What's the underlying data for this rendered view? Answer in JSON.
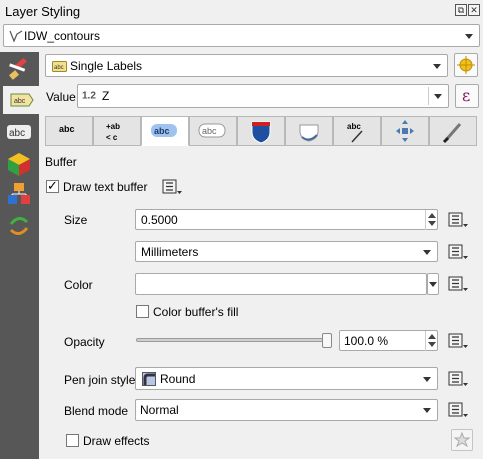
{
  "panel": {
    "title": "Layer Styling"
  },
  "layer_select": {
    "value": "IDW_contours"
  },
  "renderer": {
    "value": "Single Labels"
  },
  "value_row": {
    "label": "Value",
    "type_badge": "1.2",
    "value": "Z"
  },
  "tabs": [
    {
      "name": "text",
      "glyph": "abc"
    },
    {
      "name": "formatting",
      "glyph": "+ab c"
    },
    {
      "name": "buffer",
      "glyph": "abc",
      "active": true
    },
    {
      "name": "mask",
      "glyph": "abc"
    },
    {
      "name": "background",
      "glyph": ""
    },
    {
      "name": "shadow",
      "glyph": ""
    },
    {
      "name": "callouts",
      "glyph": "abc"
    },
    {
      "name": "placement",
      "glyph": ""
    },
    {
      "name": "rendering",
      "glyph": ""
    }
  ],
  "buffer": {
    "section_title": "Buffer",
    "draw_text_buffer_label": "Draw text buffer",
    "draw_text_buffer_checked": true,
    "size_label": "Size",
    "size_value": "0.5000",
    "units_value": "Millimeters",
    "color_label": "Color",
    "color_fill_label": "Color buffer's fill",
    "opacity_label": "Opacity",
    "opacity_value": "100.0 %",
    "opacity_level": 1.0,
    "pen_join_label": "Pen join style",
    "pen_join_value": "Round",
    "blend_label": "Blend mode",
    "blend_value": "Normal",
    "draw_effects_label": "Draw effects"
  },
  "colors": {
    "sidebar": "#575757",
    "buffer_color": "#ffffff"
  }
}
